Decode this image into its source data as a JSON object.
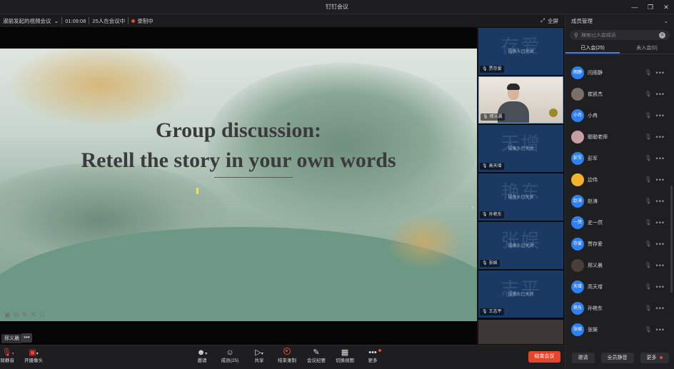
{
  "window": {
    "title": "钉钉会议"
  },
  "infobar": {
    "meeting_title": "淑丽发起的视频会议",
    "duration": "01:09:08",
    "attendees": "25人在会议中",
    "recording": "录制中",
    "fullscreen_label": "全屏"
  },
  "slide": {
    "line1": "Group discussion:",
    "line2": "Retell the story in your own words"
  },
  "speaker": {
    "name": "邢义晨"
  },
  "thumbnails": [
    {
      "bigname": "存爱",
      "status": "摄像头已关闭",
      "name": "贾存爱"
    },
    {
      "bigname": "",
      "status": "",
      "name": "邢义晨"
    },
    {
      "bigname": "天增",
      "status": "摄像头已关闭",
      "name": "高天增"
    },
    {
      "bigname": "艳东",
      "status": "摄像头已关闭",
      "name": "孙艳东"
    },
    {
      "bigname": "张娱",
      "status": "摄像头已关闭",
      "name": "张娱"
    },
    {
      "bigname": "志平",
      "status": "摄像头已关闭",
      "name": "王志平"
    }
  ],
  "panel": {
    "title": "成员管理",
    "search_placeholder": "搜索已入会成员",
    "tab_joined": "已入会(25)",
    "tab_not_joined": "未入会(0)",
    "participants": [
      {
        "avatar": "雨静",
        "name": "闫雨静"
      },
      {
        "avatar": "",
        "name": "崔凯杰"
      },
      {
        "avatar": "小冉",
        "name": "小冉"
      },
      {
        "avatar": "",
        "name": "聪聪老师"
      },
      {
        "avatar": "彭军",
        "name": "彭军"
      },
      {
        "avatar": "",
        "name": "边伟"
      },
      {
        "avatar": "赵涛",
        "name": "赵涛"
      },
      {
        "avatar": "一然",
        "name": "史一然"
      },
      {
        "avatar": "存爱",
        "name": "贾存爱"
      },
      {
        "avatar": "",
        "name": "邢义晨"
      },
      {
        "avatar": "天增",
        "name": "高天增"
      },
      {
        "avatar": "艳东",
        "name": "孙艳东"
      },
      {
        "avatar": "张娱",
        "name": "张娱"
      }
    ],
    "footer": {
      "invite": "邀请",
      "mute_all": "全员静音",
      "more": "更多"
    }
  },
  "toolbar": {
    "mute": "解除静音",
    "camera": "开摄像头",
    "invite": "邀请",
    "members": "成员(25)",
    "share": "共享",
    "stop_record": "结束录制",
    "minutes": "会议纪要",
    "switch_view": "切换视图",
    "more": "更多",
    "end_meeting": "结束会议"
  }
}
